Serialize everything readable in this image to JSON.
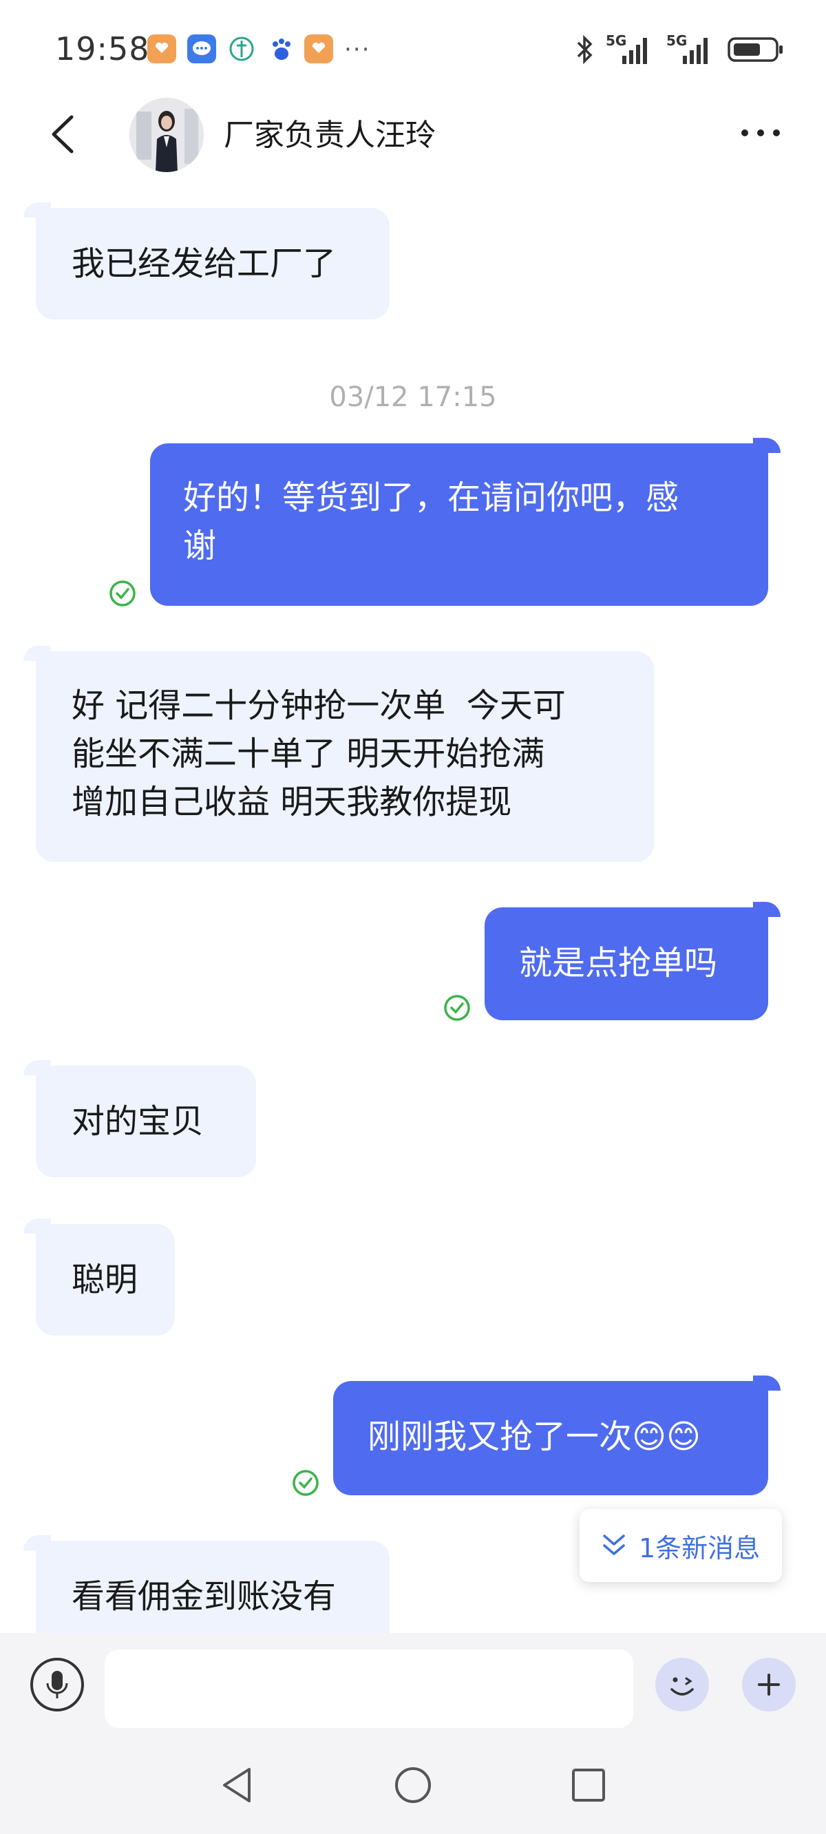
{
  "status_bar": {
    "time": "19:58",
    "more": "···",
    "network_1": "5G",
    "network_2": "5G",
    "apps": [
      "health-app-icon",
      "message-app-icon",
      "grid-app-icon",
      "baidu-app-icon",
      "health-app-icon"
    ]
  },
  "header": {
    "contact_name": "厂家负责人汪玲"
  },
  "messages": [
    {
      "direction": "in",
      "text": "我已经发给工厂了"
    },
    {
      "type": "timestamp",
      "text": "03/12 17:15"
    },
    {
      "direction": "out",
      "lines": [
        "好的！等货到了，在请问你吧，感",
        "谢"
      ],
      "read": true
    },
    {
      "direction": "in",
      "lines": [
        "好 记得二十分钟抢一次单  今天可",
        "能坐不满二十单了 明天开始抢满",
        "增加自己收益 明天我教你提现"
      ]
    },
    {
      "direction": "out",
      "text": "就是点抢单吗",
      "read": true
    },
    {
      "direction": "in",
      "text": "对的宝贝"
    },
    {
      "direction": "in",
      "text": "聪明"
    },
    {
      "direction": "out",
      "text": "刚刚我又抢了一次😊😊",
      "read": true
    },
    {
      "direction": "in",
      "text": "看看佣金到账没有"
    }
  ],
  "new_message_prompt": "1条新消息",
  "input": {
    "value": "",
    "placeholder": ""
  },
  "colors": {
    "outgoing_bubble": "#4f6bef",
    "incoming_bubble": "#eef3fe",
    "read_check": "#3cb34a",
    "accent": "#3f6fe0"
  }
}
